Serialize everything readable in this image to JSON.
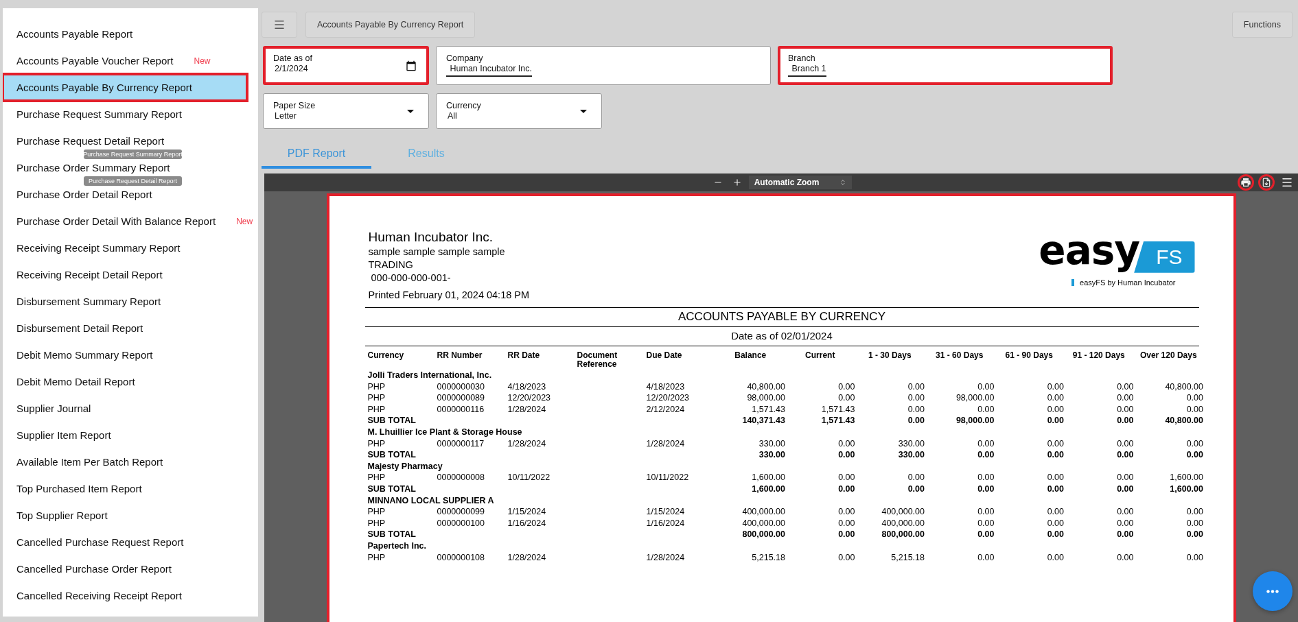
{
  "sidebar": {
    "items": [
      {
        "label": "Accounts Payable Report",
        "selected": false,
        "highlighted": false
      },
      {
        "label": "Accounts Payable Voucher Report",
        "badge": "New",
        "selected": false,
        "highlighted": false
      },
      {
        "label": "Accounts Payable By Currency Report",
        "selected": true,
        "highlighted": true
      },
      {
        "label": "Purchase Request Summary Report",
        "selected": false,
        "highlighted": false
      },
      {
        "label": "Purchase Request Detail Report",
        "selected": false,
        "highlighted": false
      },
      {
        "label": "Purchase Order Summary Report",
        "selected": false,
        "highlighted": false
      },
      {
        "label": "Purchase Order Detail Report",
        "selected": false,
        "highlighted": false
      },
      {
        "label": "Purchase Order Detail With Balance Report",
        "badge": "New",
        "selected": false,
        "highlighted": false
      },
      {
        "label": "Receiving Receipt Summary Report",
        "selected": false,
        "highlighted": false
      },
      {
        "label": "Receiving Receipt Detail Report",
        "selected": false,
        "highlighted": false
      },
      {
        "label": "Disbursement Summary Report",
        "selected": false,
        "highlighted": false
      },
      {
        "label": "Disbursement Detail Report",
        "selected": false,
        "highlighted": false
      },
      {
        "label": "Debit Memo Summary Report",
        "selected": false,
        "highlighted": false
      },
      {
        "label": "Debit Memo Detail Report",
        "selected": false,
        "highlighted": false
      },
      {
        "label": "Supplier Journal",
        "selected": false,
        "highlighted": false
      },
      {
        "label": "Supplier Item Report",
        "selected": false,
        "highlighted": false
      },
      {
        "label": "Available Item Per Batch Report",
        "selected": false,
        "highlighted": false
      },
      {
        "label": "Top Purchased Item Report",
        "selected": false,
        "highlighted": false
      },
      {
        "label": "Top Supplier Report",
        "selected": false,
        "highlighted": false
      },
      {
        "label": "Cancelled Purchase Request Report",
        "selected": false,
        "highlighted": false
      },
      {
        "label": "Cancelled Purchase Order Report",
        "selected": false,
        "highlighted": false
      },
      {
        "label": "Cancelled Receiving Receipt Report",
        "selected": false,
        "highlighted": false
      }
    ],
    "drag_ghosts": [
      "Purchase Request Summary Report",
      "Purchase Request Detail Report"
    ]
  },
  "toolbar": {
    "title": "Accounts Payable By Currency Report",
    "functions": "Functions"
  },
  "filter_rows": [
    [
      {
        "kind": "date",
        "label": "Date as of",
        "value": "2/1/2024",
        "highlighted": true
      },
      {
        "kind": "text",
        "label": "Company",
        "value": "Human Incubator Inc.",
        "highlighted": false
      },
      {
        "kind": "text",
        "label": "Branch",
        "value": "Branch 1",
        "highlighted": true
      }
    ],
    [
      {
        "kind": "select",
        "label": "Paper Size",
        "value": "Letter",
        "highlighted": false
      },
      {
        "kind": "select",
        "label": "Currency",
        "value": "All",
        "highlighted": false
      }
    ]
  ],
  "tabs": [
    {
      "label": "PDF Report",
      "selected": true
    },
    {
      "label": "Results",
      "selected": false
    }
  ],
  "viewer": {
    "zoom": "Automatic Zoom",
    "tools": [
      {
        "kind": "print",
        "highlighted": true
      },
      {
        "kind": "download",
        "highlighted": true
      },
      {
        "kind": "menu",
        "highlighted": false
      }
    ],
    "report": {
      "highlighted": true,
      "company": "Human Incubator Inc.",
      "lines": [
        "sample sample sample sample",
        "TRADING",
        " 000-000-000-001-"
      ],
      "printed": "Printed February 01, 2024 04:18 PM",
      "logo": {
        "word": "easy",
        "badge": "FS",
        "tagline": "easyFS by Human Incubator"
      },
      "title": "ACCOUNTS PAYABLE BY CURRENCY",
      "subtitle": "Date as of 02/01/2024",
      "columns": [
        "Currency",
        "RR Number",
        "RR Date",
        "Document Reference",
        "Due Date",
        "Balance",
        "Current",
        "1 - 30 Days",
        "31 - 60 Days",
        "61 - 90 Days",
        "91 - 120 Days",
        "Over 120 Days"
      ],
      "groups": [
        {
          "name": "Jolli Traders International, Inc.",
          "rows": [
            {
              "currency": "PHP",
              "rr_number": "0000000030",
              "rr_date": "4/18/2023",
              "due_date": "4/18/2023",
              "amounts": [
                "40,800.00",
                "0.00",
                "0.00",
                "0.00",
                "0.00",
                "0.00",
                "40,800.00"
              ]
            },
            {
              "currency": "PHP",
              "rr_number": "0000000089",
              "rr_date": "12/20/2023",
              "due_date": "12/20/2023",
              "amounts": [
                "98,000.00",
                "0.00",
                "0.00",
                "98,000.00",
                "0.00",
                "0.00",
                "0.00"
              ]
            },
            {
              "currency": "PHP",
              "rr_number": "0000000116",
              "rr_date": "1/28/2024",
              "due_date": "2/12/2024",
              "amounts": [
                "1,571.43",
                "1,571.43",
                "0.00",
                "0.00",
                "0.00",
                "0.00",
                "0.00"
              ]
            }
          ],
          "subtotal": {
            "label": "SUB TOTAL",
            "amounts": [
              "140,371.43",
              "1,571.43",
              "0.00",
              "98,000.00",
              "0.00",
              "0.00",
              "40,800.00"
            ]
          }
        },
        {
          "name": "M. Lhuillier Ice Plant & Storage House",
          "rows": [
            {
              "currency": "PHP",
              "rr_number": "0000000117",
              "rr_date": "1/28/2024",
              "due_date": "1/28/2024",
              "amounts": [
                "330.00",
                "0.00",
                "330.00",
                "0.00",
                "0.00",
                "0.00",
                "0.00"
              ]
            }
          ],
          "subtotal": {
            "label": "SUB TOTAL",
            "amounts": [
              "330.00",
              "0.00",
              "330.00",
              "0.00",
              "0.00",
              "0.00",
              "0.00"
            ]
          }
        },
        {
          "name": "Majesty Pharmacy",
          "rows": [
            {
              "currency": "PHP",
              "rr_number": "0000000008",
              "rr_date": "10/11/2022",
              "due_date": "10/11/2022",
              "amounts": [
                "1,600.00",
                "0.00",
                "0.00",
                "0.00",
                "0.00",
                "0.00",
                "1,600.00"
              ]
            }
          ],
          "subtotal": {
            "label": "SUB TOTAL",
            "amounts": [
              "1,600.00",
              "0.00",
              "0.00",
              "0.00",
              "0.00",
              "0.00",
              "1,600.00"
            ]
          }
        },
        {
          "name": "MINNANO LOCAL SUPPLIER A",
          "rows": [
            {
              "currency": "PHP",
              "rr_number": "0000000099",
              "rr_date": "1/15/2024",
              "due_date": "1/15/2024",
              "amounts": [
                "400,000.00",
                "0.00",
                "400,000.00",
                "0.00",
                "0.00",
                "0.00",
                "0.00"
              ]
            },
            {
              "currency": "PHP",
              "rr_number": "0000000100",
              "rr_date": "1/16/2024",
              "due_date": "1/16/2024",
              "amounts": [
                "400,000.00",
                "0.00",
                "400,000.00",
                "0.00",
                "0.00",
                "0.00",
                "0.00"
              ]
            }
          ],
          "subtotal": {
            "label": "SUB TOTAL",
            "amounts": [
              "800,000.00",
              "0.00",
              "800,000.00",
              "0.00",
              "0.00",
              "0.00",
              "0.00"
            ]
          }
        },
        {
          "name": "Papertech Inc.",
          "rows": [
            {
              "currency": "PHP",
              "rr_number": "0000000108",
              "rr_date": "1/28/2024",
              "due_date": "1/28/2024",
              "amounts": [
                "5,215.18",
                "0.00",
                "5,215.18",
                "0.00",
                "0.00",
                "0.00",
                "0.00"
              ]
            }
          ]
        }
      ]
    }
  }
}
